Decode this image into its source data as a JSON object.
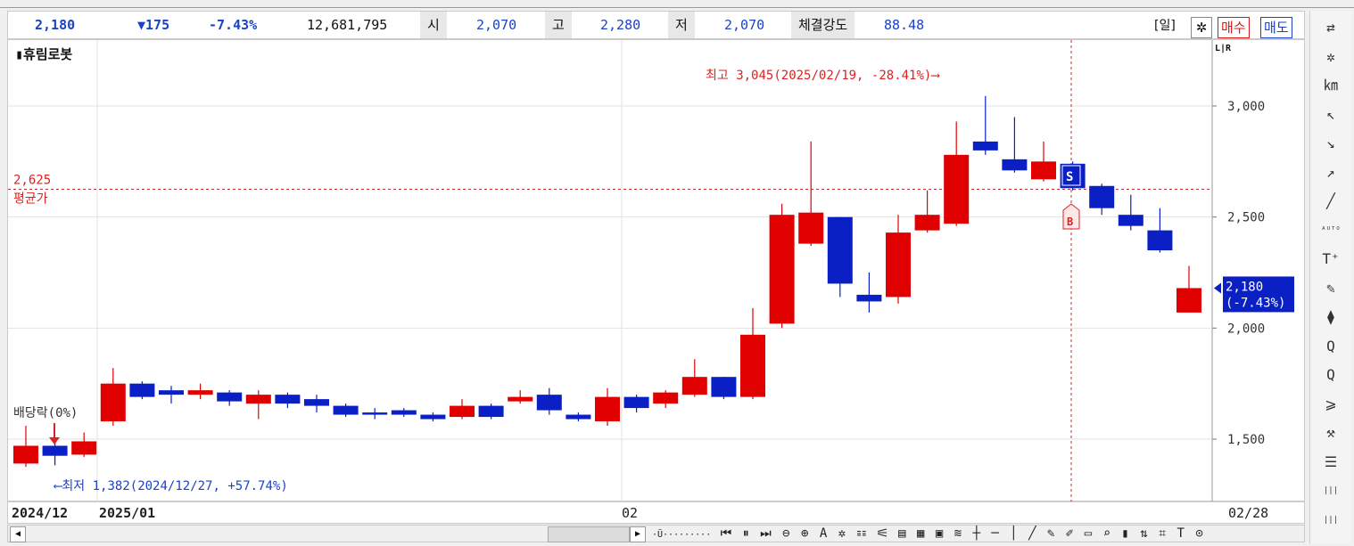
{
  "header": {
    "price": "2,180",
    "change": "▼175",
    "change_pct": "-7.43%",
    "volume": "12,681,795",
    "open_label": "시",
    "open": "2,070",
    "high_label": "고",
    "high": "2,280",
    "low_label": "저",
    "low": "2,070",
    "strength_label": "체결강도",
    "strength": "88.48",
    "period_button": "[일]",
    "buy_button": "매수",
    "sell_button": "매도"
  },
  "chart_data": {
    "type": "candlestick",
    "title": "휴림로봇",
    "y_ticks": [
      1500,
      2000,
      2500,
      3000
    ],
    "y_tick_labels": [
      "1,500",
      "2,000",
      "2,500",
      "3,000"
    ],
    "x_labels": [
      "2024/12",
      "2025/01",
      "02",
      "02/28"
    ],
    "ylim": [
      1300,
      3250
    ],
    "avg_price": {
      "value": 2625,
      "label_value": "2,625",
      "label": "평균가"
    },
    "high_annotation": "최고 3,045(2025/02/19, -28.41%)⟶",
    "low_annotation": "⟵최저 1,382(2024/12/27, +57.74%)",
    "dividend_annotation": "배당락(0%)",
    "last_price": {
      "value": 2180,
      "label": "2,180",
      "pct": "(-7.43%)"
    },
    "lr_label": "L|R",
    "buy_marker": "B",
    "sell_marker": "S",
    "candles": [
      {
        "o": 1390,
        "h": 1560,
        "l": 1375,
        "c": 1470
      },
      {
        "o": 1470,
        "h": 1500,
        "l": 1382,
        "c": 1425
      },
      {
        "o": 1430,
        "h": 1530,
        "l": 1420,
        "c": 1490
      },
      {
        "o": 1580,
        "h": 1820,
        "l": 1560,
        "c": 1750
      },
      {
        "o": 1750,
        "h": 1760,
        "l": 1680,
        "c": 1690
      },
      {
        "o": 1720,
        "h": 1740,
        "l": 1660,
        "c": 1700
      },
      {
        "o": 1700,
        "h": 1750,
        "l": 1680,
        "c": 1720
      },
      {
        "o": 1710,
        "h": 1720,
        "l": 1650,
        "c": 1670
      },
      {
        "o": 1660,
        "h": 1720,
        "l": 1590,
        "c": 1700
      },
      {
        "o": 1700,
        "h": 1710,
        "l": 1640,
        "c": 1660
      },
      {
        "o": 1680,
        "h": 1700,
        "l": 1620,
        "c": 1650
      },
      {
        "o": 1650,
        "h": 1660,
        "l": 1600,
        "c": 1610
      },
      {
        "o": 1620,
        "h": 1640,
        "l": 1590,
        "c": 1610
      },
      {
        "o": 1630,
        "h": 1640,
        "l": 1600,
        "c": 1610
      },
      {
        "o": 1610,
        "h": 1620,
        "l": 1580,
        "c": 1590
      },
      {
        "o": 1600,
        "h": 1680,
        "l": 1590,
        "c": 1650
      },
      {
        "o": 1650,
        "h": 1660,
        "l": 1590,
        "c": 1600
      },
      {
        "o": 1670,
        "h": 1720,
        "l": 1660,
        "c": 1690
      },
      {
        "o": 1700,
        "h": 1730,
        "l": 1610,
        "c": 1630
      },
      {
        "o": 1610,
        "h": 1620,
        "l": 1580,
        "c": 1590
      },
      {
        "o": 1580,
        "h": 1730,
        "l": 1560,
        "c": 1690
      },
      {
        "o": 1690,
        "h": 1700,
        "l": 1620,
        "c": 1640
      },
      {
        "o": 1660,
        "h": 1720,
        "l": 1640,
        "c": 1710
      },
      {
        "o": 1700,
        "h": 1860,
        "l": 1690,
        "c": 1780
      },
      {
        "o": 1780,
        "h": 1780,
        "l": 1680,
        "c": 1690
      },
      {
        "o": 1690,
        "h": 2090,
        "l": 1680,
        "c": 1970
      },
      {
        "o": 2020,
        "h": 2560,
        "l": 2000,
        "c": 2510
      },
      {
        "o": 2380,
        "h": 2840,
        "l": 2370,
        "c": 2520
      },
      {
        "o": 2500,
        "h": 2500,
        "l": 2140,
        "c": 2200
      },
      {
        "o": 2150,
        "h": 2250,
        "l": 2070,
        "c": 2120
      },
      {
        "o": 2140,
        "h": 2510,
        "l": 2110,
        "c": 2430
      },
      {
        "o": 2440,
        "h": 2620,
        "l": 2430,
        "c": 2510
      },
      {
        "o": 2470,
        "h": 2930,
        "l": 2460,
        "c": 2780
      },
      {
        "o": 2840,
        "h": 3045,
        "l": 2780,
        "c": 2800
      },
      {
        "o": 2760,
        "h": 2950,
        "l": 2700,
        "c": 2710
      },
      {
        "o": 2670,
        "h": 2840,
        "l": 2660,
        "c": 2750
      },
      {
        "o": 2740,
        "h": 2750,
        "l": 2620,
        "c": 2630
      },
      {
        "o": 2640,
        "h": 2650,
        "l": 2510,
        "c": 2540
      },
      {
        "o": 2510,
        "h": 2600,
        "l": 2440,
        "c": 2460
      },
      {
        "o": 2440,
        "h": 2540,
        "l": 2340,
        "c": 2350
      },
      {
        "o": 2070,
        "h": 2280,
        "l": 2070,
        "c": 2180
      }
    ]
  },
  "toolbar": {
    "tools": "⏮ ⏸ ⏭ ⊖ ⊕ A ✲ ☷ ⚟ ▤ ▦ ▣ ≋ ┼ ─ │ ╱ ✎ ✐ ▭ ⌕ ▮ ⇅ ⌗ T ⊙",
    "zoom": "·Ū·········"
  },
  "right_toolbar": [
    "⇄",
    "✲",
    "㎞",
    "↖",
    "↘",
    "↗",
    "╱",
    "ᴬᵁᵀᴼ",
    "T⁺",
    "✎",
    "⧫",
    "Q",
    "Q",
    "⩾",
    "⚒",
    "☰",
    "|||",
    "|||"
  ]
}
